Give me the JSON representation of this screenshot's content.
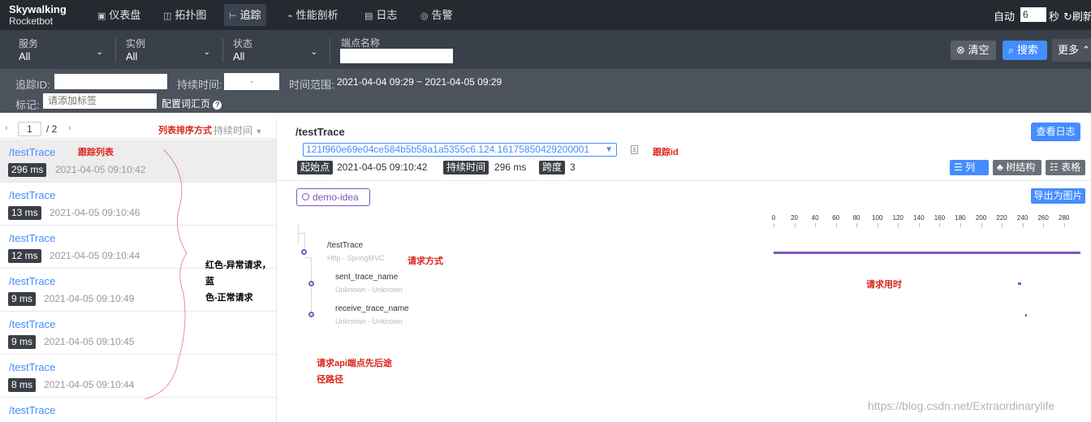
{
  "header": {
    "logo_line1": "Skywalking",
    "logo_line2": "Rocketbot",
    "nav": [
      {
        "label": "仪表盘",
        "icon": "dashboard-icon",
        "glyph": "▣"
      },
      {
        "label": "拓扑图",
        "icon": "topology-icon",
        "glyph": "◫"
      },
      {
        "label": "追踪",
        "icon": "trace-icon",
        "glyph": "⊢"
      },
      {
        "label": "性能剖析",
        "icon": "profile-icon",
        "glyph": "⌁"
      },
      {
        "label": "日志",
        "icon": "log-icon",
        "glyph": "▤"
      },
      {
        "label": "告警",
        "icon": "alarm-icon",
        "glyph": "◎"
      }
    ],
    "auto_label": "自动",
    "auto_value": "6",
    "seconds_label": "秒",
    "refresh_label": "刷新"
  },
  "filters": {
    "service": {
      "label": "服务",
      "value": "All"
    },
    "instance": {
      "label": "实例",
      "value": "All"
    },
    "status": {
      "label": "状态",
      "value": "All"
    },
    "endpoint_label": "端点名称",
    "clear_label": "清空",
    "search_label": "搜索",
    "more_label": "更多"
  },
  "subfilters": {
    "trace_id_label": "追踪ID:",
    "duration_label": "持续时间:",
    "duration_sep": "-",
    "time_range_label": "时间范围:",
    "time_range_value": "2021-04-04 09:29 ~ 2021-04-05 09:29",
    "tags_label": "标记:",
    "tags_placeholder": "请添加标签",
    "config_label": "配置词汇页"
  },
  "list": {
    "page": "1",
    "page_total": "/ 2",
    "sort_annotation": "列表排序方式",
    "sort_label": "持续时间",
    "items": [
      {
        "name": "/testTrace",
        "duration": "296 ms",
        "time": "2021-04-05 09:10:42"
      },
      {
        "name": "/testTrace",
        "duration": "13 ms",
        "time": "2021-04-05 09:10:46"
      },
      {
        "name": "/testTrace",
        "duration": "12 ms",
        "time": "2021-04-05 09:10:44"
      },
      {
        "name": "/testTrace",
        "duration": "9 ms",
        "time": "2021-04-05 09:10:49"
      },
      {
        "name": "/testTrace",
        "duration": "9 ms",
        "time": "2021-04-05 09:10:45"
      },
      {
        "name": "/testTrace",
        "duration": "8 ms",
        "time": "2021-04-05 09:10:44"
      },
      {
        "name": "/testTrace",
        "duration": "",
        "time": ""
      }
    ]
  },
  "annotations": {
    "trace_list": "跟踪列表",
    "color_note_1": "红色-异常请求，蓝",
    "color_note_2": "色-正常请求",
    "trace_id": "跟踪id",
    "request_method": "请求方式",
    "request_time": "请求用时",
    "endpoint_path_1": "请求api端点先后途",
    "endpoint_path_2": "径路径"
  },
  "detail": {
    "title": "/testTrace",
    "view_logs_label": "查看日志",
    "trace_id": "121f960e69e04ce584b5b58a1a5355c6.124.16175850429200001",
    "start_label": "起始点",
    "start_value": "2021-04-05 09:10:42",
    "duration_label": "持续时间",
    "duration_value": "296 ms",
    "span_label": "跨度",
    "span_value": "3",
    "view_list": "列表",
    "view_tree": "树结构",
    "view_table": "表格",
    "service_badge": "demo-idea",
    "export_label": "导出为图片",
    "axis_ticks": [
      "0",
      "20",
      "40",
      "60",
      "80",
      "100",
      "120",
      "140",
      "160",
      "180",
      "200",
      "220",
      "240",
      "260",
      "280"
    ],
    "spans": [
      {
        "name": "/testTrace",
        "sub": "Http - SpringMVC",
        "start": 0,
        "duration": 296
      },
      {
        "name": "sent_trace_name",
        "sub": "Unknown - Unknown",
        "start": 236,
        "duration": 3
      },
      {
        "name": "receive_trace_name",
        "sub": "Unknown - Unknown",
        "start": 243,
        "duration": 1
      }
    ],
    "span_color": "#7e57c2"
  },
  "watermark": "https://blog.csdn.net/Extraordinarylife"
}
